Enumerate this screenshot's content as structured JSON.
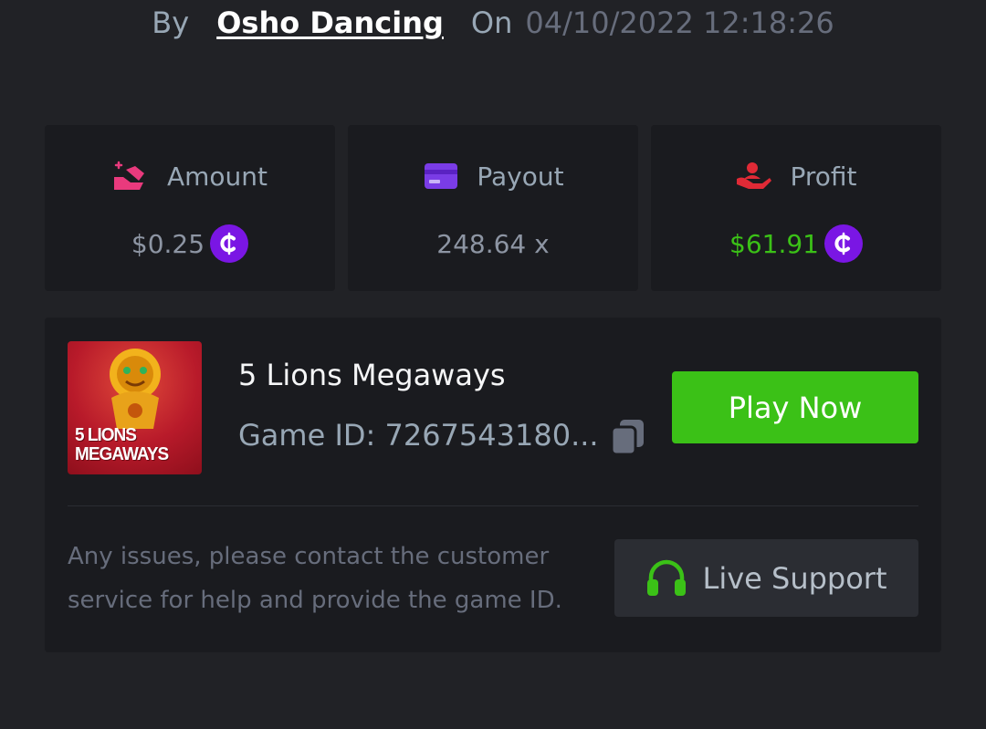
{
  "meta": {
    "by_label": "By",
    "user": "Osho Dancing",
    "on_label": "On",
    "date": "04/10/2022 12:18:26"
  },
  "stats": {
    "amount": {
      "label": "Amount",
      "value": "$0.25",
      "icon": "gem-hand-icon",
      "color": "#e93a7d"
    },
    "payout": {
      "label": "Payout",
      "value": "248.64 x",
      "icon": "card-icon",
      "color": "#7a3ce6"
    },
    "profit": {
      "label": "Profit",
      "value": "$61.91",
      "icon": "profit-hand-icon",
      "color": "#e02a36",
      "value_color": "#3bc117"
    },
    "coin_symbol": "₵"
  },
  "game": {
    "thumbnail_text_line1": "5 LIONS",
    "thumbnail_text_line2": "MEGAWAYS",
    "title": "5 Lions Megaways",
    "game_id": "Game ID: 7267543180...",
    "play_label": "Play Now",
    "copy_icon": "copy-icon"
  },
  "support": {
    "notice": "Any issues, please contact the customer service for help and provide the game ID.",
    "button_label": "Live Support",
    "icon": "headset-icon",
    "icon_color": "#3bc117"
  },
  "colors": {
    "background": "#212226",
    "card": "#1a1b1f",
    "accent_green": "#3bc117",
    "coin_purple": "#7a16e4"
  }
}
